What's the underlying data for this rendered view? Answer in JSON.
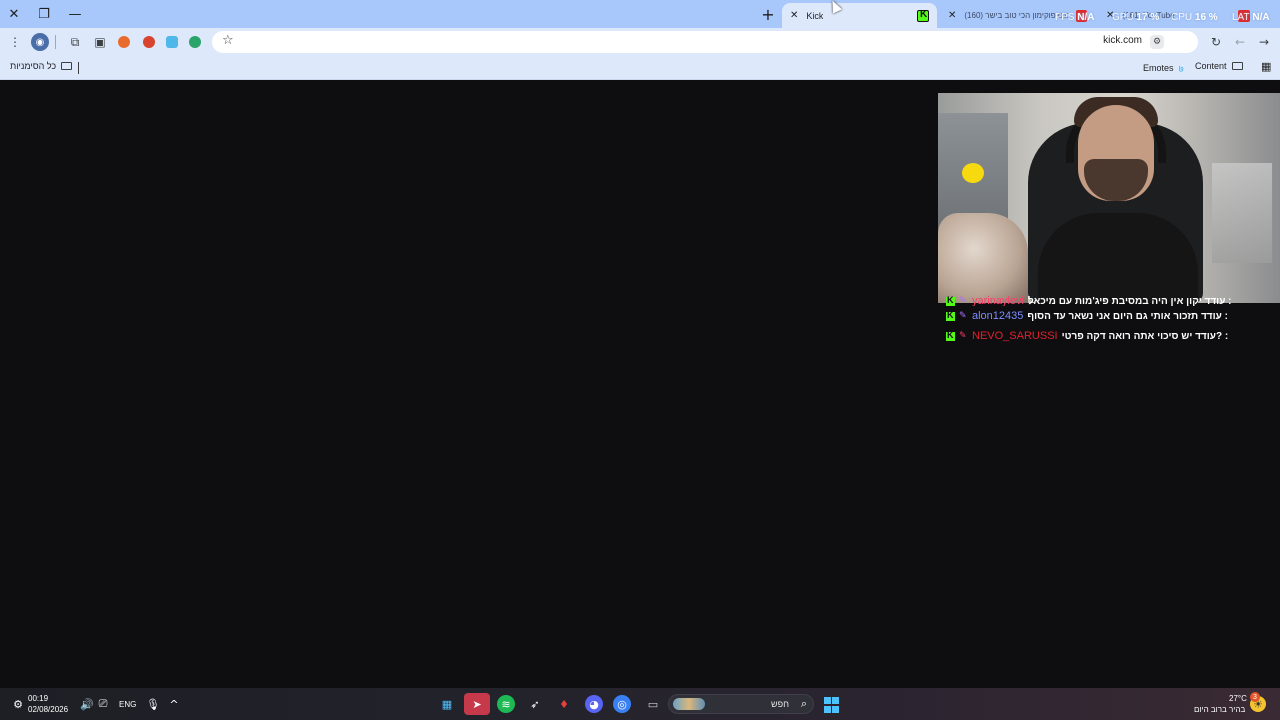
{
  "browser": {
    "tabs": [
      {
        "title": "Kick",
        "active": true
      },
      {
        "title": "(160) הכנס פוקימון הכי טוב בישר",
        "active": false
      },
      {
        "title": "(161) YouTube",
        "active": false
      }
    ],
    "window_controls": {
      "close": "✕",
      "restore": "❐",
      "minimize": "—"
    },
    "new_tab": "+",
    "url": "kick.com",
    "perf_overlay": {
      "fps_label": "FPS",
      "fps_value": "N/A",
      "gpu_label": "GPU",
      "gpu_value": "17 %",
      "cpu_label": "CPU",
      "cpu_value": "16 %",
      "lat_label": "LAT",
      "lat_value": "N/A"
    },
    "bookmarks": {
      "all_bookmarks": "כל הסימניות",
      "emotes": "Emotes",
      "content": "Content"
    }
  },
  "chat": {
    "messages": [
      {
        "user": "yarinaylevi",
        "user_color": "#ff3b6b",
        "text": "עודד יקון אין היה במסיבת פיג'מות עם מיכאל :"
      },
      {
        "user": "alon12435",
        "user_color": "#7b8cff",
        "text": "עודד תזכור אותי גם היום אני נשאר עד הסוף :"
      },
      {
        "user": "NEVO_SARUSSI",
        "user_color": "#e0202f",
        "text": "עודד יש סיכוי אתה רואה דקה פרטי? :"
      }
    ]
  },
  "taskbar": {
    "time": "00:19",
    "date": "02/08/2026",
    "language": "ENG",
    "search_label": "חפש",
    "weather_temp": "27°C",
    "weather_desc": "בהיר ברוב היום",
    "notification_count": "3"
  },
  "colors": {
    "accent": "#53fc18",
    "tabstrip": "#a8c7fa",
    "toolbar": "#dde8fb",
    "page_bg": "#0e0e10"
  }
}
